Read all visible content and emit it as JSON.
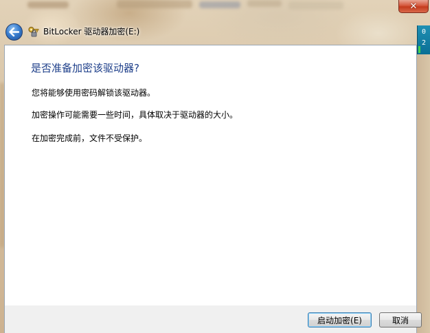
{
  "window": {
    "title": "BitLocker 驱动器加密(E:)",
    "close_glyph": "✕"
  },
  "side_widget": {
    "lines": [
      "0",
      "2"
    ]
  },
  "content": {
    "heading": "是否准备加密该驱动器?",
    "paragraphs": [
      "您将能够使用密码解锁该驱动器。",
      "加密操作可能需要一些时间，具体取决于驱动器的大小。",
      "在加密完成前，文件不受保护。"
    ]
  },
  "footer": {
    "start_label": "启动加密(E)",
    "cancel_label": "取消"
  },
  "icons": {
    "back": "back-arrow-icon",
    "app": "bitlocker-key-icon",
    "close": "close-icon"
  },
  "colors": {
    "heading": "#1e3f8a",
    "close_button": "#c43b1d",
    "back_button": "#3a7fd0",
    "panel_bg": "#ffffff",
    "footer_bg": "#f0f0f0"
  }
}
